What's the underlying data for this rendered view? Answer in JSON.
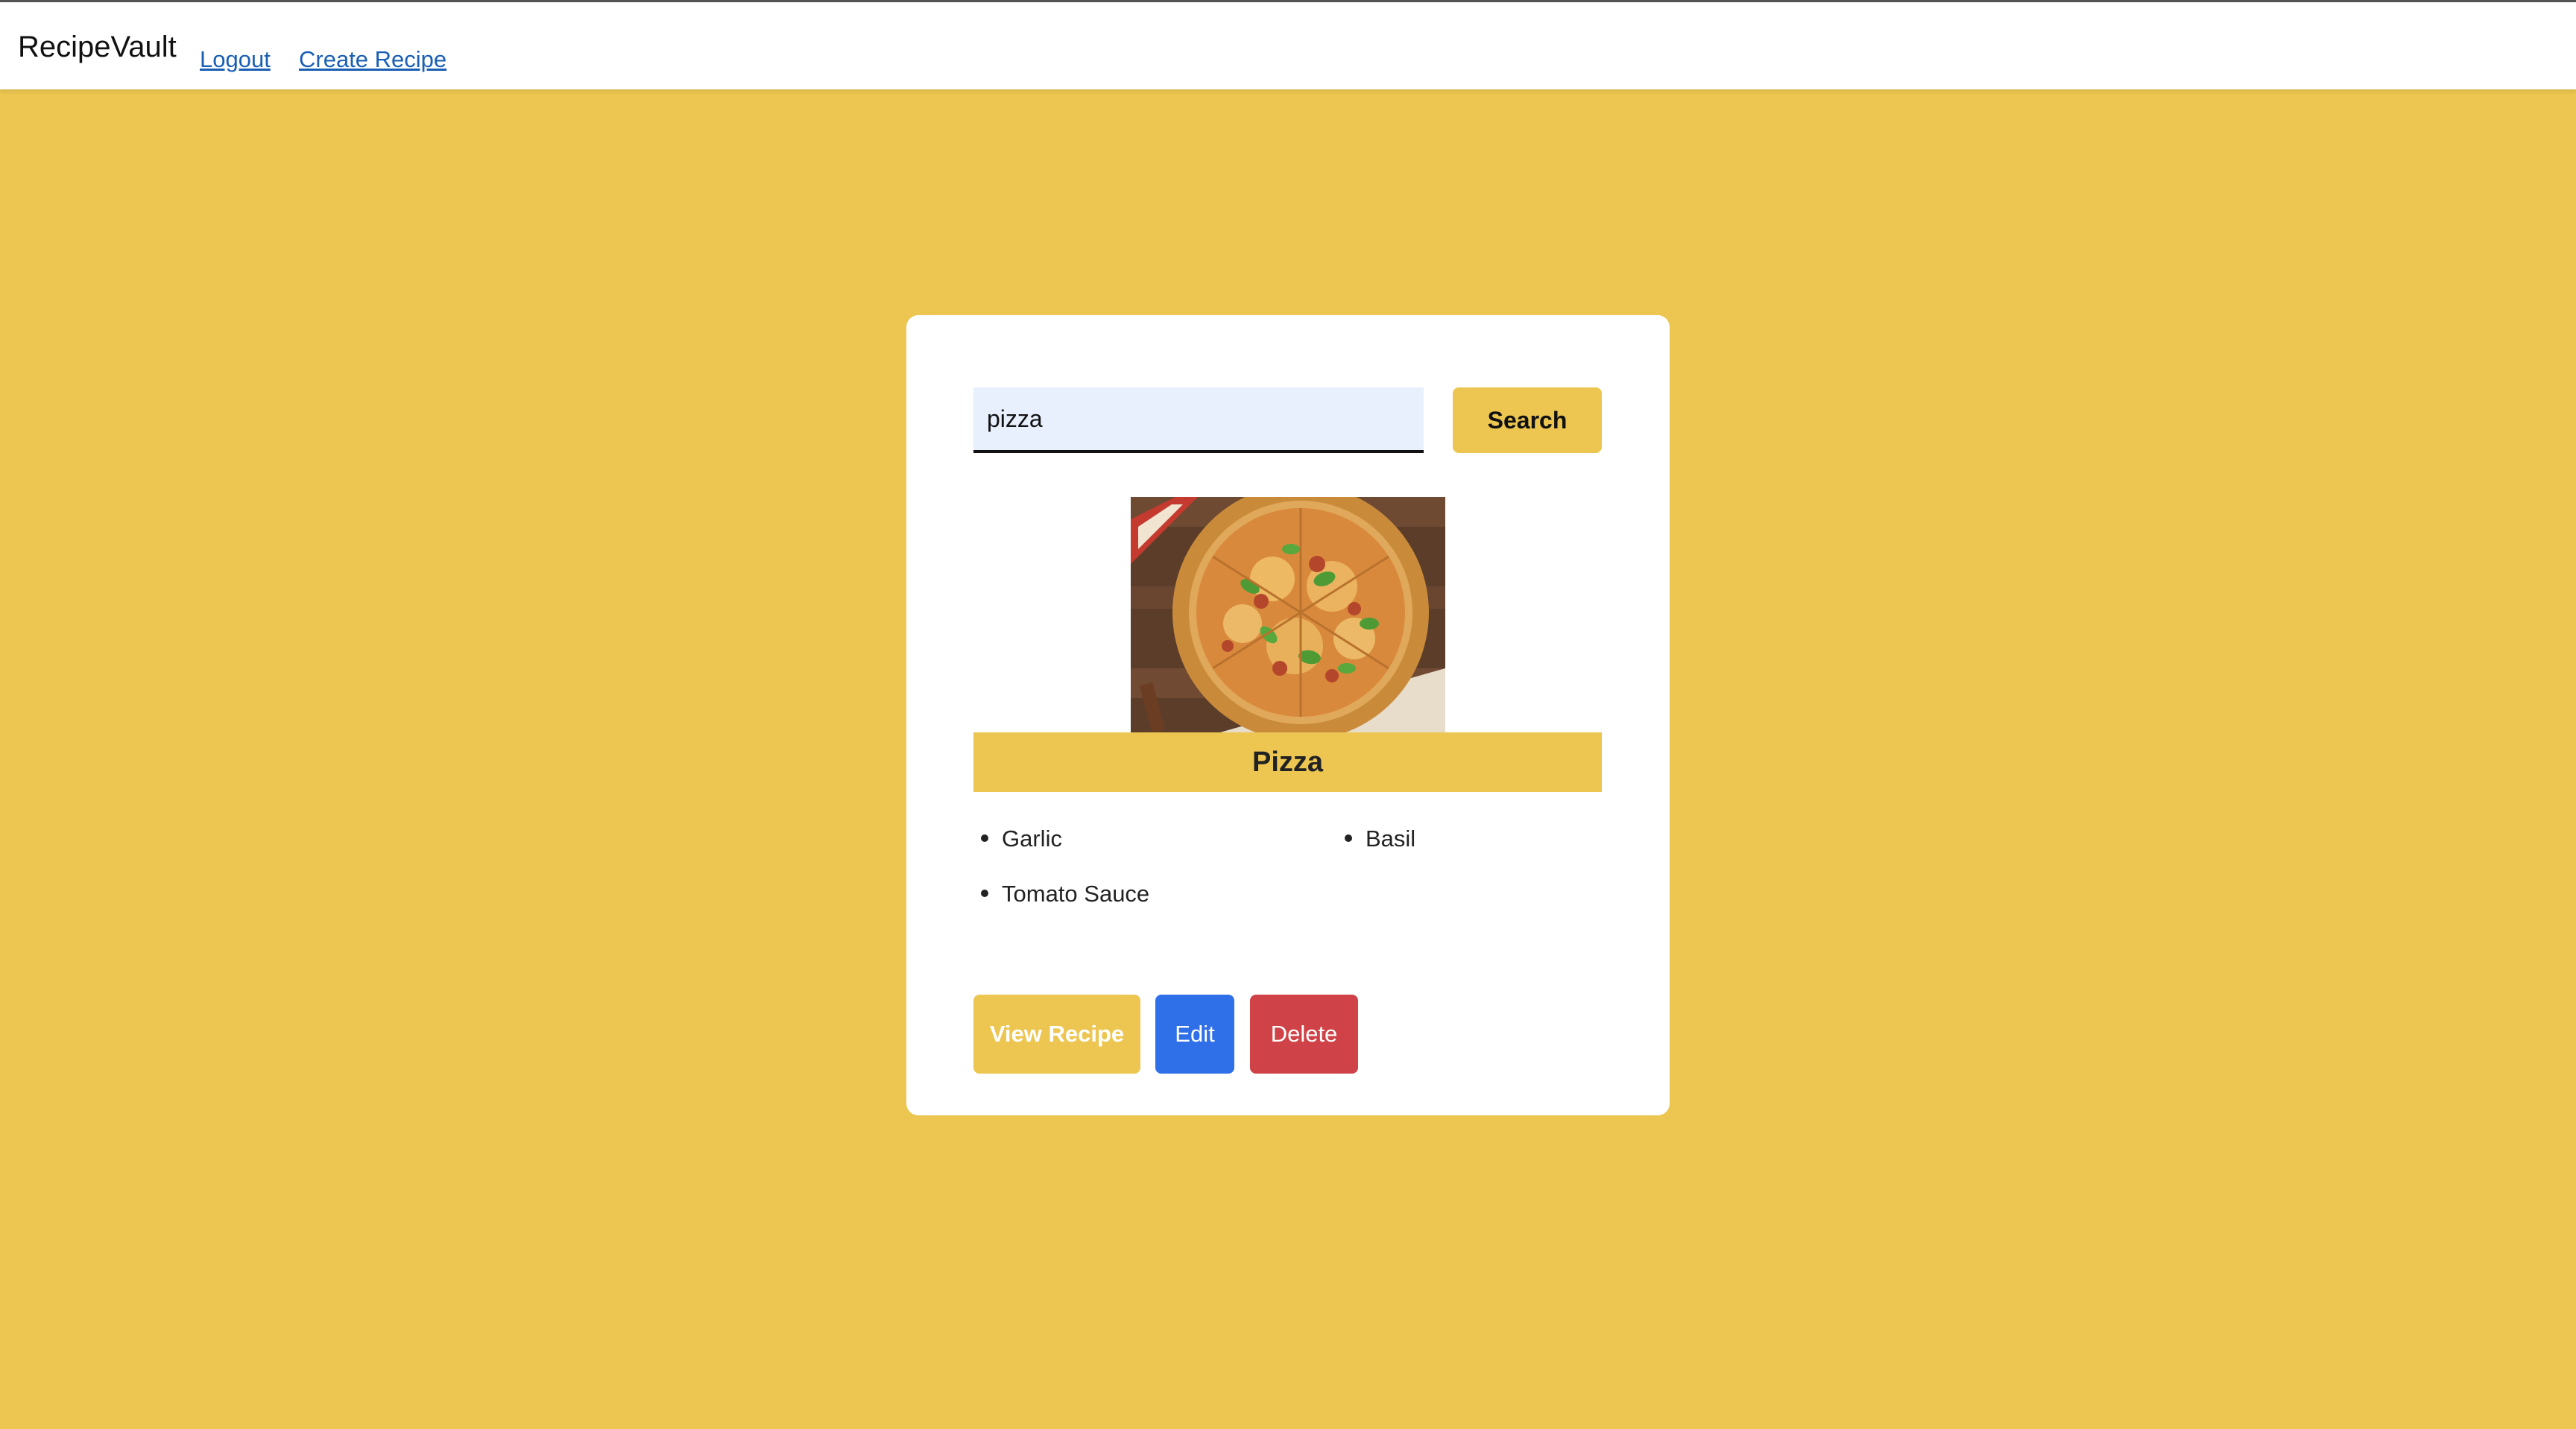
{
  "navbar": {
    "brand": "RecipeVault",
    "links": [
      "Logout",
      "Create Recipe"
    ]
  },
  "search": {
    "value": "pizza",
    "button_label": "Search"
  },
  "recipe": {
    "title": "Pizza",
    "ingredients": [
      "Garlic",
      "Basil",
      "Tomato Sauce"
    ],
    "actions": {
      "view": "View Recipe",
      "edit": "Edit",
      "delete": "Delete"
    }
  },
  "colors": {
    "background": "#ecc650",
    "card": "#ffffff",
    "accent": "#ecc650",
    "edit": "#2f6fe8",
    "delete": "#cf4348",
    "link": "#1a5fb4"
  }
}
